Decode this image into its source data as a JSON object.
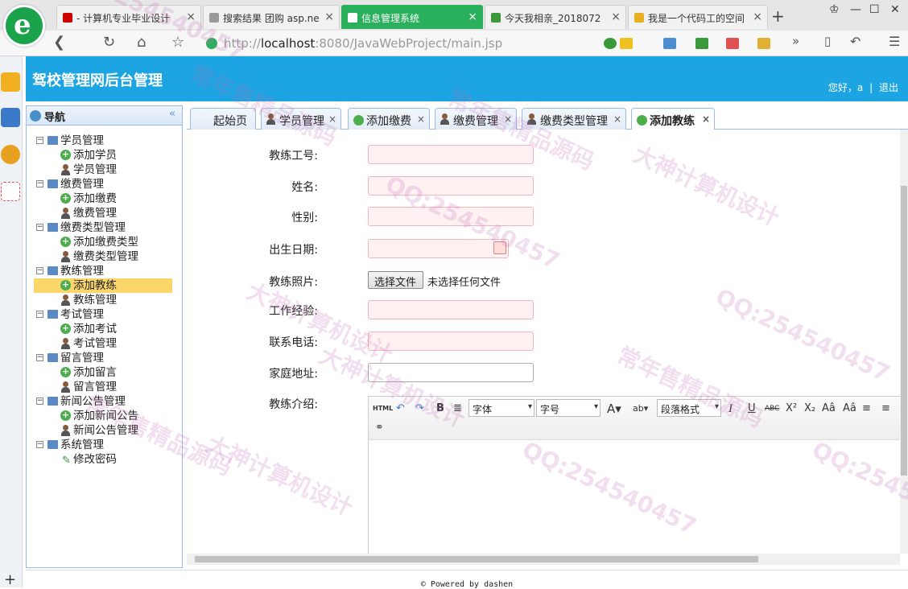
{
  "browser": {
    "tabs": [
      {
        "title": "- 计算机专业毕业设计",
        "fav": "#c00"
      },
      {
        "title": "搜索结果 团购 asp.ne",
        "fav": "#999"
      },
      {
        "title": "信息管理系统",
        "fav": "#fff",
        "active": true
      },
      {
        "title": "今天我相亲_2018072",
        "fav": "#3a9a3a"
      },
      {
        "title": "我是一个代码工的空间",
        "fav": "#e8b020"
      }
    ],
    "url_scheme": "http://",
    "url_host": "localhost",
    "url_rest": ":8080/JavaWebProject/main.jsp"
  },
  "app": {
    "title": "驾校管理网后台管理",
    "greeting": "您好，a",
    "logout": "退出"
  },
  "nav": {
    "title": "导航",
    "groups": [
      {
        "label": "学员管理",
        "items": [
          {
            "label": "添加学员",
            "icon": "add"
          },
          {
            "label": "学员管理",
            "icon": "user"
          }
        ]
      },
      {
        "label": "缴费管理",
        "items": [
          {
            "label": "添加缴费",
            "icon": "add"
          },
          {
            "label": "缴费管理",
            "icon": "user"
          }
        ]
      },
      {
        "label": "缴费类型管理",
        "items": [
          {
            "label": "添加缴费类型",
            "icon": "add"
          },
          {
            "label": "缴费类型管理",
            "icon": "user"
          }
        ]
      },
      {
        "label": "教练管理",
        "items": [
          {
            "label": "添加教练",
            "icon": "add",
            "selected": true
          },
          {
            "label": "教练管理",
            "icon": "user"
          }
        ]
      },
      {
        "label": "考试管理",
        "items": [
          {
            "label": "添加考试",
            "icon": "add"
          },
          {
            "label": "考试管理",
            "icon": "user"
          }
        ]
      },
      {
        "label": "留言管理",
        "items": [
          {
            "label": "添加留言",
            "icon": "add"
          },
          {
            "label": "留言管理",
            "icon": "user"
          }
        ]
      },
      {
        "label": "新闻公告管理",
        "items": [
          {
            "label": "添加新闻公告",
            "icon": "add"
          },
          {
            "label": "新闻公告管理",
            "icon": "user"
          }
        ]
      },
      {
        "label": "系统管理",
        "items": [
          {
            "label": "修改密码",
            "icon": "pen"
          }
        ]
      }
    ]
  },
  "content_tabs": [
    {
      "label": "起始页",
      "icon": "none",
      "closable": false
    },
    {
      "label": "学员管理",
      "icon": "user",
      "closable": true
    },
    {
      "label": "添加缴费",
      "icon": "add",
      "closable": true
    },
    {
      "label": "缴费管理",
      "icon": "user",
      "closable": true
    },
    {
      "label": "缴费类型管理",
      "icon": "user",
      "closable": true
    },
    {
      "label": "添加教练",
      "icon": "add",
      "closable": true,
      "active": true
    }
  ],
  "form": {
    "fields": [
      {
        "label": "教练工号:",
        "value": ""
      },
      {
        "label": "姓名:",
        "value": ""
      },
      {
        "label": "性别:",
        "value": ""
      },
      {
        "label": "出生日期:",
        "value": ""
      },
      {
        "label": "教练照片:",
        "value": ""
      },
      {
        "label": "工作经验:",
        "value": ""
      },
      {
        "label": "联系电话:",
        "value": ""
      },
      {
        "label": "家庭地址:",
        "value": ""
      },
      {
        "label": "教练介绍:",
        "value": ""
      }
    ],
    "file_button": "选择文件",
    "file_status": "未选择任何文件"
  },
  "editor": {
    "font_select": "字体",
    "size_select": "字号",
    "para_select": "段落格式",
    "html_btn": "HTML"
  },
  "footer": "© Powered by dashen",
  "watermarks": [
    "QQ:254540457",
    "常年售精品源码",
    "大神计算机设计"
  ]
}
